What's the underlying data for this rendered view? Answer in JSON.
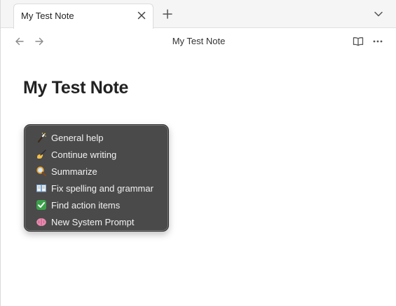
{
  "tab": {
    "title": "My Test Note",
    "close_icon": "close-icon",
    "new_tab_icon": "plus-icon",
    "tab_list_icon": "chevron-down-icon"
  },
  "header": {
    "title": "My Test Note",
    "back_icon": "arrow-left-icon",
    "forward_icon": "arrow-right-icon",
    "reading_view_icon": "book-open-icon",
    "more_icon": "more-horizontal-icon"
  },
  "note": {
    "title": "My Test Note"
  },
  "menu": {
    "items": [
      {
        "label": "General help",
        "icon": "magic-wand-icon"
      },
      {
        "label": "Continue writing",
        "icon": "writing-hand-icon"
      },
      {
        "label": "Summarize",
        "icon": "magnifying-glass-icon"
      },
      {
        "label": "Fix spelling and grammar",
        "icon": "open-book-icon"
      },
      {
        "label": "Find action items",
        "icon": "check-mark-button-icon"
      },
      {
        "label": "New System Prompt",
        "icon": "brain-icon"
      }
    ]
  },
  "colors": {
    "menu_background": "#4a4a4a",
    "check_green": "#3ba14a",
    "brain_pink": "#e98bb0"
  }
}
